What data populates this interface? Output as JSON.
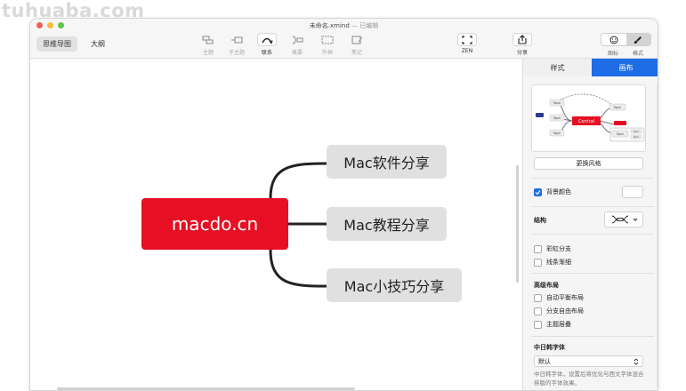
{
  "watermark": "tuhuaba.com",
  "window": {
    "title": "未命名.xmind",
    "separator": " — ",
    "status": "已编辑"
  },
  "mode_switch": {
    "items": [
      "思维导图",
      "大纲"
    ],
    "active": "思维导图"
  },
  "toolbar": {
    "topic": "主题",
    "subtopic": "子主题",
    "relationship": "联系",
    "summary": "概要",
    "boundary": "外框",
    "note": "笔记",
    "zen": "ZEN",
    "share": "分享",
    "icons_panel": "图标",
    "format_panel": "格式"
  },
  "mindmap": {
    "central": "macdo.cn",
    "subtopics": [
      "Mac软件分享",
      "Mac教程分享",
      "Mac小技巧分享"
    ]
  },
  "colors": {
    "central_fill": "#e60f23",
    "subtopic_fill": "#e0e0e0",
    "accent": "#1e6de6",
    "connector": "#222222"
  },
  "sidebar": {
    "tabs": [
      "样式",
      "画布"
    ],
    "active_tab": "画布",
    "thumbnail": {
      "central": "Central",
      "topic": "Topic"
    },
    "change_style_button": "更换风格",
    "background_color": {
      "label": "背景颜色",
      "checked": true
    },
    "structure_label": "结构",
    "rainbow_branch": {
      "label": "彩虹分支",
      "checked": false
    },
    "line_gradient": {
      "label": "线条渐细",
      "checked": false
    },
    "advanced_layout_label": "高级布局",
    "auto_balance": {
      "label": "自动平衡布局",
      "checked": false
    },
    "free_branch": {
      "label": "分支自由布局",
      "checked": false
    },
    "topic_overlap": {
      "label": "主题层叠",
      "checked": false
    },
    "cjk_font_label": "中日韩字体",
    "cjk_font_value": "默认",
    "cjk_font_hint": "中日韩字体，设置后将优化与西文字体混合排版的字体效果。"
  }
}
